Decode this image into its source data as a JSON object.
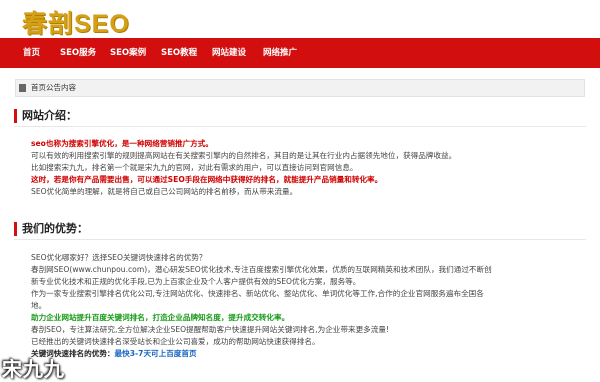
{
  "site": {
    "logo_text": "春剖SEO"
  },
  "nav": {
    "items": [
      {
        "label": "首页"
      },
      {
        "label": "SEO服务"
      },
      {
        "label": "SEO案例"
      },
      {
        "label": "SEO教程"
      },
      {
        "label": "网站建设"
      },
      {
        "label": "网络推广"
      }
    ]
  },
  "announcement": {
    "icon": "announcement-icon",
    "text": "首页公告内容"
  },
  "intro": {
    "title": "网站介绍：",
    "lines": [
      "seo也称为搜索引擎优化，是一种网络营销推广方式。",
      "可以有效的利用搜索引擎的规则提高网站在有关搜索引擎内的自然排名，其目的是让其在行业内占据领先地位，获得品牌收益。",
      "比如搜索宋九九，排名第一个就是宋九九的官网，对此有需求的用户，可以直接访问到官网信息。",
      "这时，若是你有产品需要出售，可以通过SEO手段在网络中获得好的排名，就能提升产品销量和转化率。",
      "SEO优化简单的理解，就是将自己或自己公司网站的排名前移，而从带来流量。"
    ]
  },
  "advantages": {
    "title": "我们的优势：",
    "lines": [
      "SEO优化哪家好？选择SEO关键词快速排名的优势？",
      "春剖网SEO(www.chunpou.com)，潜心研发SEO优化技术,专注百度搜索引擎优化效果，优质的互联网精英和技术团队，我们通过不断创",
      "新专业优化技术和正规的优化手段,已为上百家企业及个人客户提供有效的SEO优化方案，服务等。",
      "作为一家专业搜索引擎排名优化公司,专注网站优化、快速排名、新站优化、整站优化、单词优化等工作,合作的企业官网服务遍布全国各",
      "地。",
      "助力企业网站提升百度关键词排名，打造企业品牌知名度，提升成交转化率。",
      "春剖SEO，专注算法研究,全方位解决企业SEO提醒帮助客户快速提升网站关键词排名,为企业带来更多流量!",
      "已经推出的关键词快速排名深受站长和企业公司喜爱，成功的帮助网站快速获得排名。"
    ],
    "speed_label": "关键词快速排名的优势：",
    "speed_value": "最快3-7天可上百度首页"
  },
  "watermark": {
    "text": "宋九九"
  },
  "colors": {
    "nav_bg": "#d30e0e",
    "logo": "#d4a017",
    "accent_red": "#d00000",
    "accent_green": "#1a9a1a",
    "accent_blue": "#1565c0"
  }
}
